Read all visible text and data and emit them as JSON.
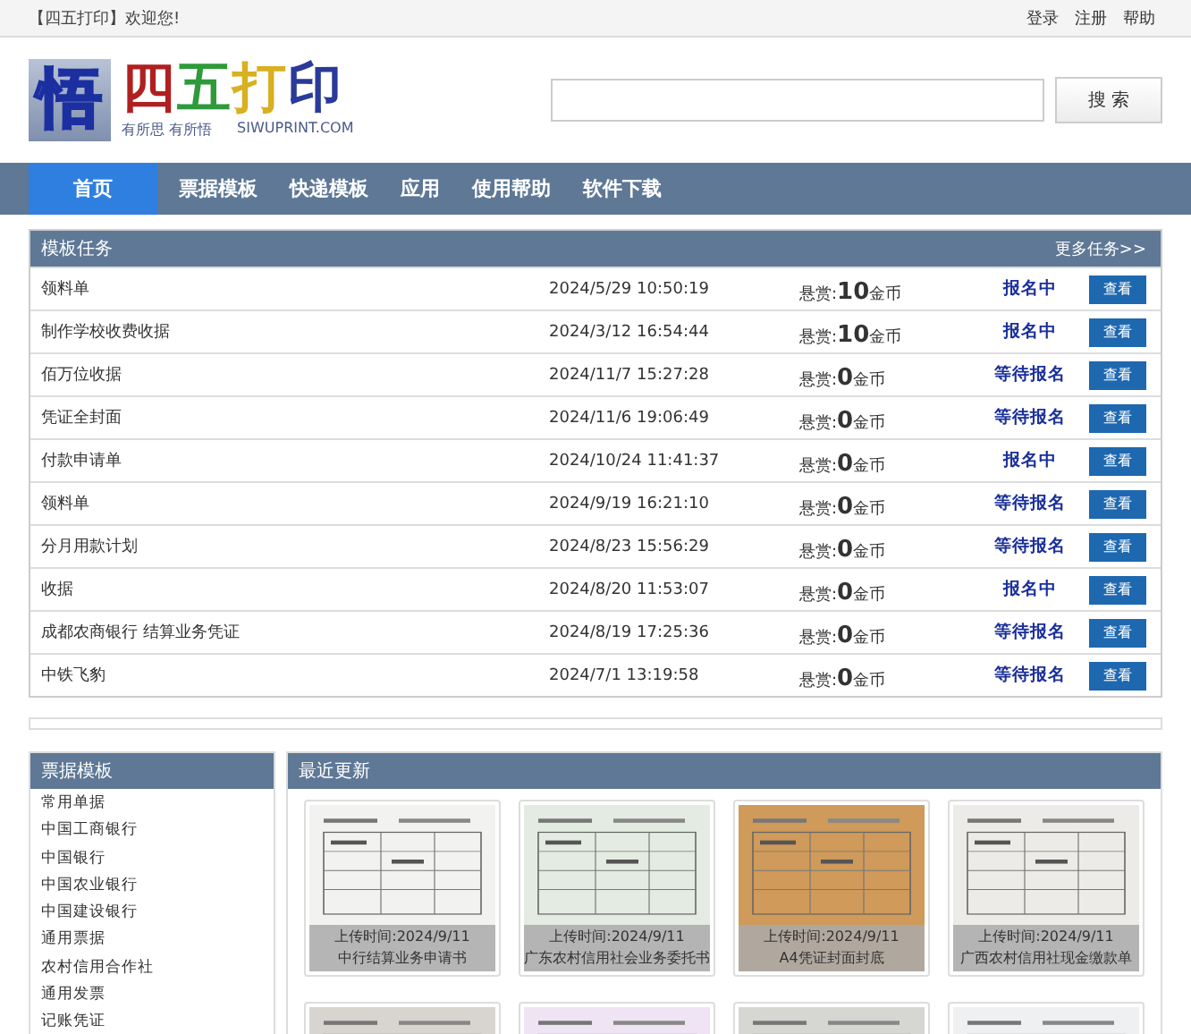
{
  "topbar": {
    "welcome": "【四五打印】欢迎您!",
    "links": [
      "登录",
      "注册",
      "帮助"
    ]
  },
  "logo": {
    "mark": "悟",
    "letters": [
      {
        "char": "四",
        "color": "#b02020"
      },
      {
        "char": "五",
        "color": "#2e9a3a"
      },
      {
        "char": "打",
        "color": "#d8b020"
      },
      {
        "char": "印",
        "color": "#2a3a9a"
      }
    ],
    "slogan": "有所思 有所悟",
    "site": "SIWUPRINT.COM"
  },
  "search": {
    "button": "搜 索"
  },
  "nav": [
    {
      "label": "首页",
      "selected": true
    },
    {
      "label": "票据模板",
      "selected": false
    },
    {
      "label": "快递模板",
      "selected": false
    },
    {
      "label": "应用",
      "selected": false
    },
    {
      "label": "使用帮助",
      "selected": false
    },
    {
      "label": "软件下载",
      "selected": false
    }
  ],
  "tasks": {
    "title": "模板任务",
    "more": "更多任务>>",
    "rows": [
      {
        "name": "领料单",
        "time": "2024/5/29 10:50:19",
        "reward_label": "悬赏:",
        "reward": "10",
        "unit": "金币",
        "status": "报名中",
        "action": "查看"
      },
      {
        "name": "制作学校收费收据",
        "time": "2024/3/12 16:54:44",
        "reward_label": "悬赏:",
        "reward": "10",
        "unit": "金币",
        "status": "报名中",
        "action": "查看"
      },
      {
        "name": "佰万位收据",
        "time": "2024/11/7 15:27:28",
        "reward_label": "悬赏:",
        "reward": "0",
        "unit": "金币",
        "status": "等待报名",
        "action": "查看"
      },
      {
        "name": "凭证全封面",
        "time": "2024/11/6 19:06:49",
        "reward_label": "悬赏:",
        "reward": "0",
        "unit": "金币",
        "status": "等待报名",
        "action": "查看"
      },
      {
        "name": "付款申请单",
        "time": "2024/10/24 11:41:37",
        "reward_label": "悬赏:",
        "reward": "0",
        "unit": "金币",
        "status": "报名中",
        "action": "查看"
      },
      {
        "name": "领料单",
        "time": "2024/9/19 16:21:10",
        "reward_label": "悬赏:",
        "reward": "0",
        "unit": "金币",
        "status": "等待报名",
        "action": "查看"
      },
      {
        "name": "分月用款计划",
        "time": "2024/8/23 15:56:29",
        "reward_label": "悬赏:",
        "reward": "0",
        "unit": "金币",
        "status": "等待报名",
        "action": "查看"
      },
      {
        "name": "收据",
        "time": "2024/8/20 11:53:07",
        "reward_label": "悬赏:",
        "reward": "0",
        "unit": "金币",
        "status": "报名中",
        "action": "查看"
      },
      {
        "name": "成都农商银行 结算业务凭证",
        "time": "2024/8/19 17:25:36",
        "reward_label": "悬赏:",
        "reward": "0",
        "unit": "金币",
        "status": "等待报名",
        "action": "查看"
      },
      {
        "name": "中铁飞豹",
        "time": "2024/7/1 13:19:58",
        "reward_label": "悬赏:",
        "reward": "0",
        "unit": "金币",
        "status": "等待报名",
        "action": "查看"
      }
    ]
  },
  "sidebar": {
    "title": "票据模板",
    "items": [
      "常用单据",
      "中国工商银行",
      "中国银行",
      "中国农业银行",
      "中国建设银行",
      "通用票据",
      "农村信用合作社",
      "通用发票",
      "记账凭证"
    ]
  },
  "recent": {
    "title": "最近更新",
    "cards": [
      {
        "kind": "caption",
        "uploaded": "上传时间:2024/9/11",
        "title": "中行结算业务申请书"
      },
      {
        "kind": "caption",
        "uploaded": "上传时间:2024/9/11",
        "title": "广东农村信用社会业务委托书"
      },
      {
        "kind": "caption",
        "uploaded": "上传时间:2024/9/11",
        "title": "A4凭证封面封底"
      },
      {
        "kind": "caption",
        "uploaded": "上传时间:2024/9/11",
        "title": "广西农村信用社现金缴款单"
      },
      {
        "kind": "picture"
      },
      {
        "kind": "picture"
      },
      {
        "kind": "picture"
      },
      {
        "kind": "picture"
      }
    ]
  }
}
